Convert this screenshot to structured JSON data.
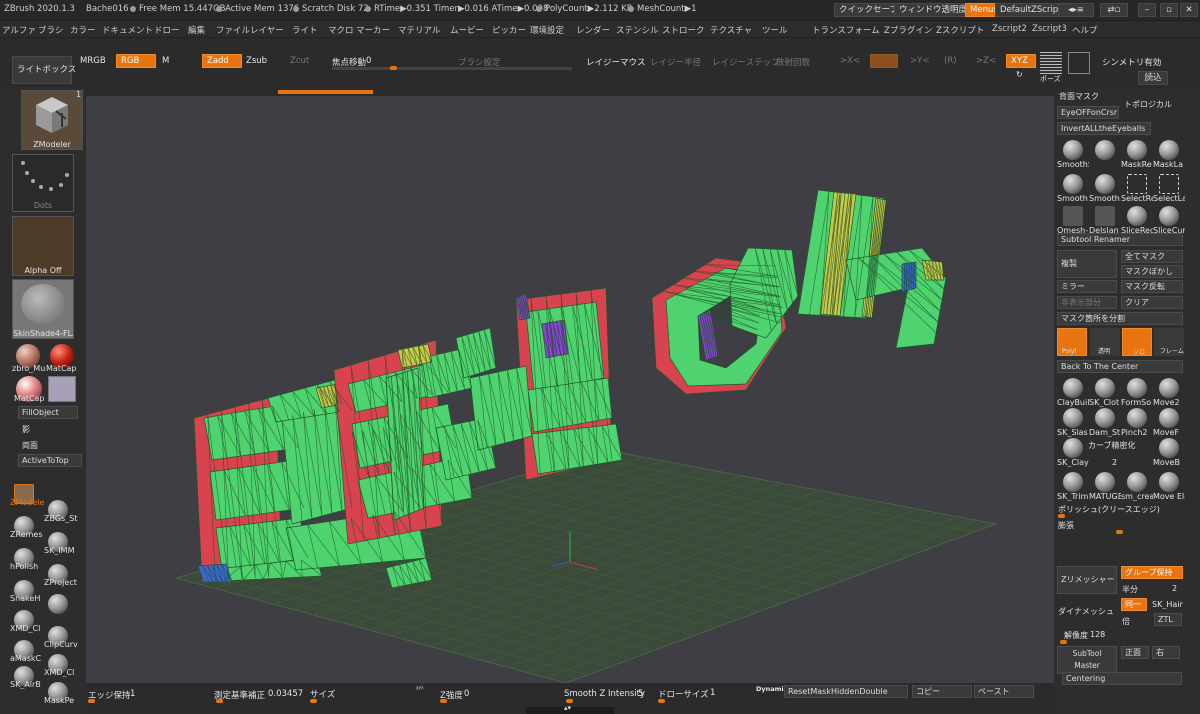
{
  "titlebar": {
    "app": "ZBrush 2020.1.3",
    "doc": "Bache016",
    "free_mem": "Free Mem 15.447GB",
    "active_mem": "Active Mem 1376",
    "scratch": "Scratch Disk 72",
    "rtime": "RTime▶0.351 Timer▶0.016 ATime▶0.008",
    "polycount": "PolyCount▶2.112 KP",
    "meshcount": "MeshCount▶1",
    "quicksave": "クイックセーブ",
    "transparency": "ウィンドウ透明度",
    "menus": "Menus",
    "script": "DefaultZScript"
  },
  "menubar": {
    "items": [
      "アルファ",
      "ブラシ",
      "カラー",
      "ドキュメント",
      "ドロー",
      "編集",
      "ファイル",
      "レイヤー",
      "ライト",
      "マクロ",
      "マーカー",
      "マテリアル",
      "ムービー",
      "ピッカー",
      "環境設定",
      "レンダー",
      "ステンシル",
      "ストローク",
      "テクスチャ",
      "ツール",
      "トランスフォーム",
      "Zプラグイン",
      "Zスクリプト",
      "Zscript2",
      "Zscript3",
      "ヘルプ"
    ]
  },
  "toolbar": {
    "lightbox": "ライトボックス",
    "mrgb": "MRGB",
    "rgb": "RGB",
    "m": "M",
    "zadd": "Zadd",
    "zsub": "Zsub",
    "zcut": "Zcut",
    "focal_label": "焦点移動",
    "focal_value": "0",
    "brush_settings": "ブラシ設定",
    "lazy_mouse": "レイジーマウス",
    "lazy_radius": "レイジー半径",
    "lazy_step": "レイジーステップ",
    "radial_count": "放射回数",
    "x_sym": ">X<",
    "y_sym": ">Y<",
    "r_sym": "(R)",
    "z_sym": ">Z<",
    "xyz": "XYZ",
    "pose": "ポーズ",
    "symmetry": "シンメトリ有効",
    "load": "読込"
  },
  "leftpanel": {
    "zmodeler": "ZModeler",
    "count": "1",
    "dots": "Dots",
    "alpha_off": "Alpha Off",
    "texture": "SkinShade4-FLA",
    "mat1": "zbro_Mu",
    "mat2": "MatCap",
    "mat3": "MatCap",
    "fill_object": "FillObject",
    "shadow": "影",
    "both_sides": "両面",
    "active_to_top": "ActiveToTop",
    "brushes": [
      {
        "name": "ZModele",
        "num": ""
      },
      {
        "name": "ZBGs_St",
        "num": ""
      },
      {
        "name": "ZRemes",
        "num": "5"
      },
      {
        "name": "SK_IMM",
        "num": ""
      },
      {
        "name": "hPolish",
        "num": ""
      },
      {
        "name": "ZProject",
        "num": ""
      },
      {
        "name": "SnakeH",
        "num": ""
      },
      {
        "name": "",
        "num": ""
      },
      {
        "name": "XMD_Cl",
        "num": ""
      },
      {
        "name": "ClipCurv",
        "num": ""
      },
      {
        "name": "aMaskC",
        "num": ""
      },
      {
        "name": "XMD_Cl",
        "num": ""
      },
      {
        "name": "SK_AirB",
        "num": ""
      },
      {
        "name": "MaskPe",
        "num": ""
      }
    ]
  },
  "rightpanel": {
    "backface_mask": "背面マスク",
    "topological": "トポロジカル",
    "eye_off": "EyeOFFonCrsr",
    "invert_eyes": "InvertALLtheEyeballs",
    "brushes_row1": [
      "SmoothSmooth",
      "",
      "MaskRe",
      "MaskLa"
    ],
    "brushes_row2": [
      "Smooth",
      "Smooth",
      "SelectRe",
      "SelectLa"
    ],
    "brushes_row3": [
      "Qmesh-",
      "Delslan",
      "SliceRec",
      "SliceCur"
    ],
    "subtool_renamer": "Subtool Renamer",
    "duplicate": "複製",
    "mask_all": "全てマスク",
    "mask_blur": "マスクぼかし",
    "mirror": "ミラー",
    "mask_invert": "マスク反転",
    "hidden_split": "非表示部分",
    "clear": "クリア",
    "split_mask": "マスク箇所を分割",
    "polyf": "Polyf",
    "transparent": "透明",
    "solo": "ソロ",
    "frame": "フレーム",
    "back_center": "Back To The Center",
    "brushes_row4": [
      "ClayBuil",
      "SK_Clot",
      "FormSo",
      "Move2"
    ],
    "brushes_row5": [
      "SK_Slas",
      "Dam_St",
      "Pinch2",
      "MoveF"
    ],
    "curve_precise": "カーブ精密化",
    "curve_val": "2",
    "brushes_row6": [
      "SK_Clay",
      "",
      "",
      "MoveB"
    ],
    "brushes_row7": [
      "SK_Trim",
      "MATUGE",
      "sm_crea",
      "Move Ela"
    ],
    "polish": "ポリッシュ(クリースエッジ)",
    "inflate": "膨張",
    "zremesher": "Zリメッシャー",
    "keep_groups": "グループ保持",
    "half": "半分",
    "num2": "2",
    "dynamesh": "ダイナメッシュ",
    "same": "同一",
    "double": "倍",
    "sk_hair": "SK_Hair",
    "ztl": "ZTL",
    "resolution": "解像度",
    "res_val": "128",
    "subtool_master": "SubTool Master",
    "front": "正面",
    "right": "右",
    "centering": "Centering"
  },
  "bottombar": {
    "edge_keep": "エッジ保持",
    "edge_val": "1",
    "measure": "測定基準補正",
    "measure_val": "0.03457",
    "size": "サイズ",
    "z_intensity": "Z強度",
    "z_val": "0",
    "smooth_z": "Smooth Z Intensity",
    "smooth_val": "5",
    "draw_size": "ドローサイズ",
    "draw_val": "1",
    "dynamic": "Dynamic",
    "reset_mask": "ResetMaskHiddenDouble",
    "copy": "コピー",
    "paste": "ペースト"
  },
  "colors": {
    "accent": "#e8740f",
    "canvas_bg": "#3f3e45",
    "mesh_green": "#4fd36e",
    "mesh_red": "#d9434f",
    "mesh_yellow": "#c8c84a",
    "mesh_blue": "#3c68d4",
    "mesh_purple": "#8a45d4"
  }
}
